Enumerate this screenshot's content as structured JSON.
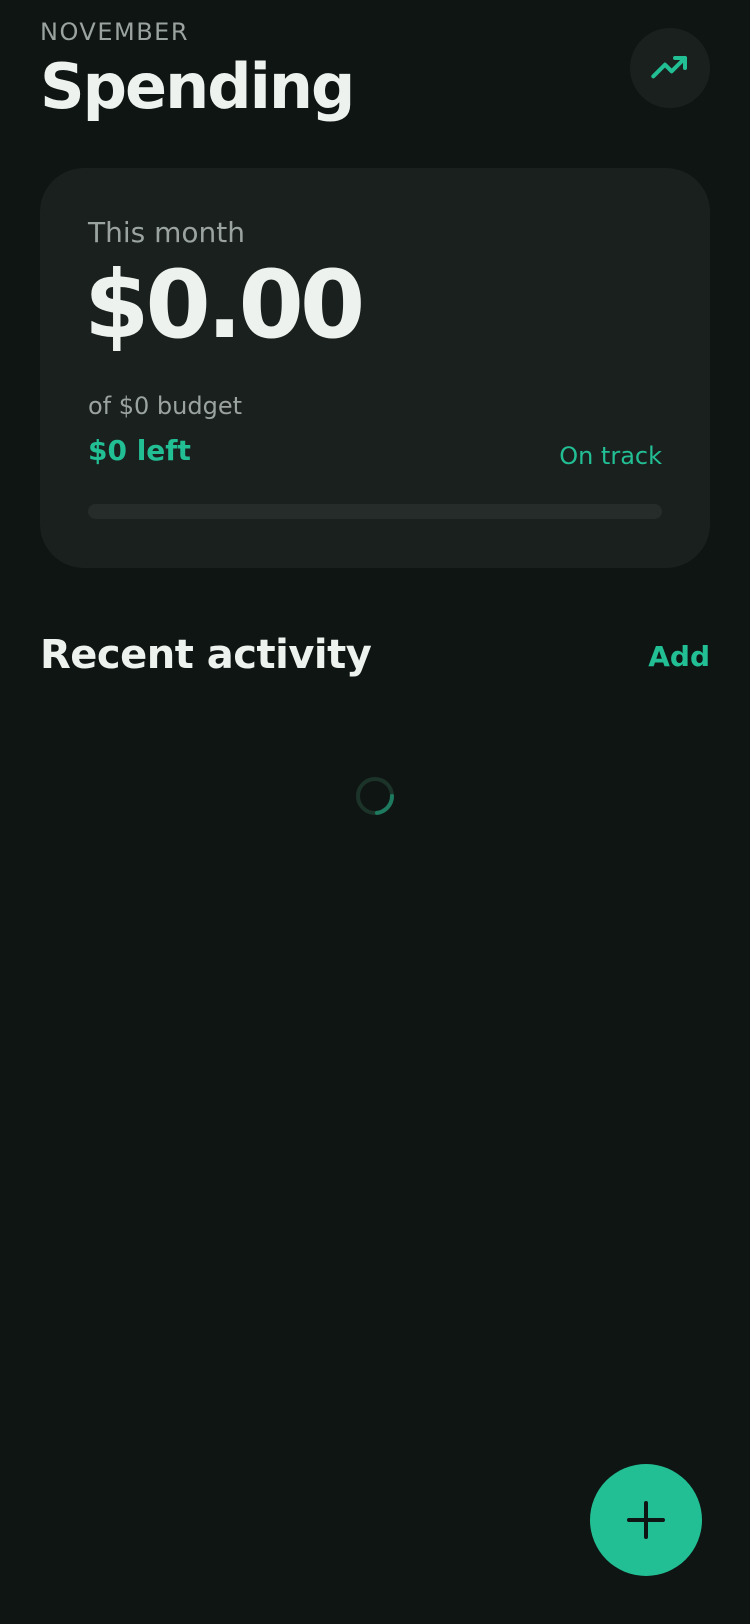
{
  "header": {
    "month": "NOVEMBER",
    "title": "Spending",
    "trend_icon": "trending-up-icon"
  },
  "summary_card": {
    "label": "This month",
    "amount": "$0.00",
    "budget": "of $0 budget",
    "left": "$0 left",
    "status": "On track",
    "progress_percent": 0
  },
  "activity": {
    "title": "Recent activity",
    "add_label": "Add",
    "loading_icon": "loading-spinner-icon"
  },
  "fab": {
    "icon": "plus-icon"
  },
  "colors": {
    "background": "#0f1513",
    "card": "#1a201e",
    "accent": "#22bf95",
    "text_primary": "#eef2ee",
    "text_secondary": "#9aa39f"
  }
}
